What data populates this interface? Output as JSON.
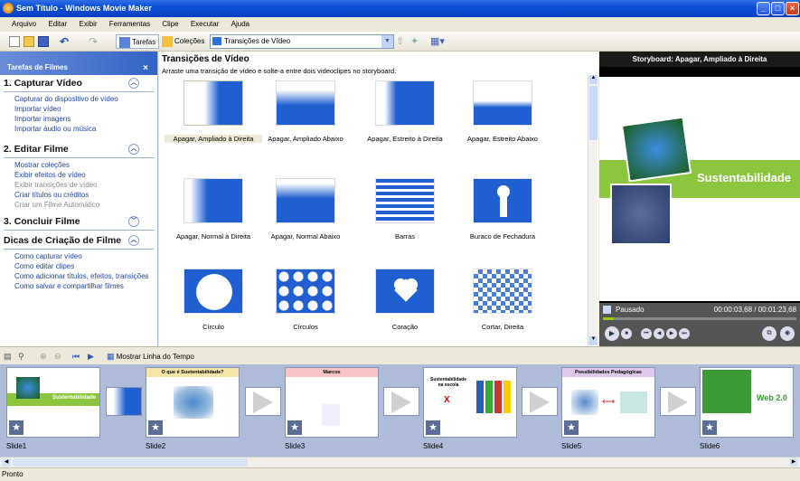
{
  "window": {
    "title": "Sem Título - Windows Movie Maker"
  },
  "menu": [
    "Arquivo",
    "Editar",
    "Exibir",
    "Ferramentas",
    "Clipe",
    "Executar",
    "Ajuda"
  ],
  "toolbar": {
    "tasks_label": "Tarefas",
    "collections_label": "Coleções",
    "collection_selected": "Transições de Vídeo"
  },
  "tasks": {
    "header": "Tarefas de Filmes",
    "close": "×",
    "sections": [
      {
        "title": "1. Capturar Vídeo",
        "links": [
          "Capturar do dispositivo de vídeo",
          "Importar vídeo",
          "Importar imagens",
          "Importar áudio ou música"
        ]
      },
      {
        "title": "2. Editar Filme",
        "links": [
          "Mostrar coleções",
          "Exibir efeitos de vídeo",
          "Exibir transições de vídeo",
          "Criar títulos ou créditos",
          "Criar um Filme Automático"
        ]
      },
      {
        "title": "3. Concluir Filme",
        "links": []
      },
      {
        "title": "Dicas de Criação de Filme",
        "links": [
          "Como capturar vídeo",
          "Como editar clipes",
          "Como adicionar títulos, efeitos, transições",
          "Como salvar e compartilhar filmes"
        ]
      }
    ]
  },
  "content": {
    "title": "Transições de Vídeo",
    "subtitle": "Arraste uma transição de vídeo e solte-a entre dois videoclipes no storyboard.",
    "transitions": [
      "Apagar, Ampliado à Direita",
      "Apagar, Ampliado Abaixo",
      "Apagar, Estreito à Direita",
      "Apagar, Estreito Abaixo",
      "Apagar, Normal à Direita",
      "Apagar, Normal Abaixo",
      "Barras",
      "Buraco de Fechadura",
      "Círculo",
      "Círculos",
      "Coração",
      "Cortar, Direita"
    ]
  },
  "preview": {
    "title": "Storyboard: Apagar, Ampliado à Direita",
    "slide_text": "Sustentabilidade",
    "status": "Pausado",
    "time": "00:00:03,68 / 00:01:23,68"
  },
  "timeline": {
    "show_timeline_label": "Mostrar Linha do Tempo"
  },
  "storyboard": {
    "slides": [
      {
        "label": "Slide1",
        "text": "Sustentabilidade"
      },
      {
        "label": "Slide2",
        "text": "O que é Sustentabilidade?"
      },
      {
        "label": "Slide3",
        "text": "Marcos"
      },
      {
        "label": "Slide4",
        "text": "Sustentabilidade na escola"
      },
      {
        "label": "Slide5",
        "text": "Possibilidades Pedagógicas"
      },
      {
        "label": "Slide6",
        "text": "Web 2.0"
      }
    ]
  },
  "status": "Pronto",
  "colors": {
    "title_blue": "#0b4fd8",
    "transition_blue": "#1f5fd0",
    "storyboard_bg": "#aebbd9",
    "green_band": "#8cc63f"
  }
}
